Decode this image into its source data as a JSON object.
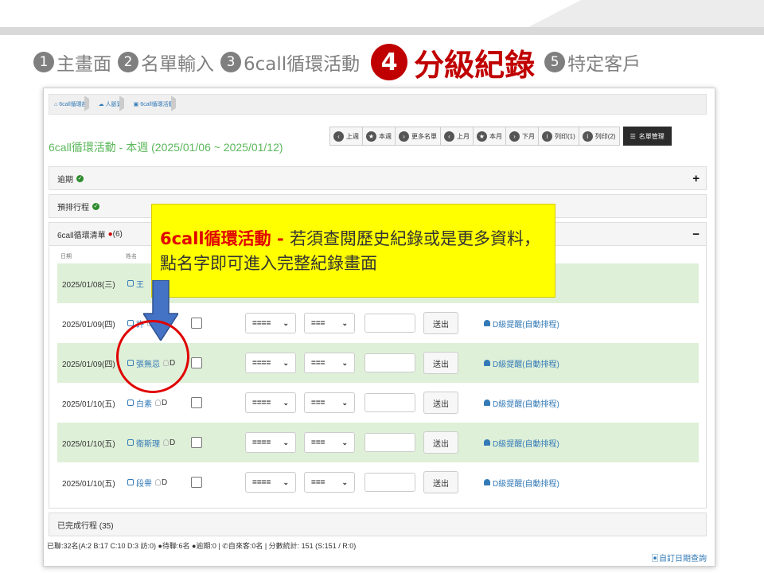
{
  "steps": [
    {
      "num": "1",
      "label": "主畫面"
    },
    {
      "num": "2",
      "label": "名單輸入"
    },
    {
      "num": "3",
      "label": "6call循環活動"
    },
    {
      "num": "4",
      "label": "分級紀錄"
    },
    {
      "num": "5",
      "label": "特定客戶"
    }
  ],
  "breadcrumb": [
    "6call循環部",
    "人脈寶",
    "6call循環活動"
  ],
  "page_title": "6call循環活動 - 本週 (2025/01/06 ~ 2025/01/12)",
  "toolbar": [
    "上週",
    "本週",
    "更多名單",
    "上月",
    "本月",
    "下月",
    "列印(1)",
    "列印(2)"
  ],
  "toolbar_manage": "名單管理",
  "panels": {
    "overdue": "逾期",
    "scheduled": "預排行程",
    "list": "6call循環清單",
    "list_count": "(6)",
    "completed": "已完成行程 (35)"
  },
  "columns": {
    "date": "日期",
    "name": "姓名"
  },
  "rows": [
    {
      "date": "2025/01/08(三)",
      "name": "王",
      "grade": "",
      "sel1": "",
      "sel2": "",
      "send": "",
      "remind": ""
    },
    {
      "date": "2025/01/09(四)",
      "name": "許",
      "grade": "D",
      "sel1": "====",
      "sel2": "===",
      "send": "送出",
      "remind": "D級提醒(自動排程)"
    },
    {
      "date": "2025/01/09(四)",
      "name": "張無忌",
      "grade": "D",
      "sel1": "====",
      "sel2": "===",
      "send": "送出",
      "remind": "D級提醒(自動排程)"
    },
    {
      "date": "2025/01/10(五)",
      "name": "白素",
      "grade": "D",
      "sel1": "====",
      "sel2": "===",
      "send": "送出",
      "remind": "D級提醒(自動排程)"
    },
    {
      "date": "2025/01/10(五)",
      "name": "衛斯理",
      "grade": "D",
      "sel1": "====",
      "sel2": "===",
      "send": "送出",
      "remind": "D級提醒(自動排程)"
    },
    {
      "date": "2025/01/10(五)",
      "name": "段譽",
      "grade": "D",
      "sel1": "====",
      "sel2": "===",
      "send": "送出",
      "remind": "D級提醒(自動排程)"
    }
  ],
  "footer": "已聯:32名(A:2 B:17 C:10 D:3 訪:0) ●待聯:6名 ●逾期:0 | ✆自來客:0名 | 分數統計: 151 (S:151 / R:0)",
  "custom_query": "自訂日期查詢",
  "callout": {
    "highlight": "6call循環活動 - ",
    "text": "若須查閱歷史紀錄或是更多資料，點名字即可進入完整紀錄畫面"
  },
  "colors": {
    "accent": "#c00000",
    "green": "#5cb85c",
    "link": "#337ab7",
    "callout": "#ffff00"
  }
}
